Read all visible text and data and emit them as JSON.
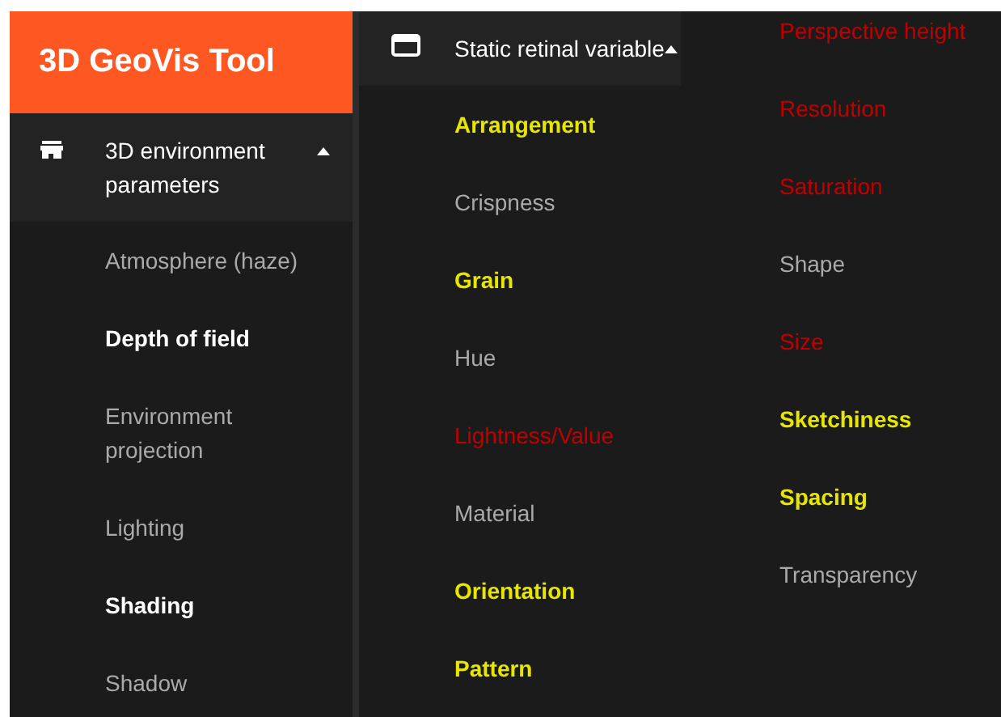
{
  "app": {
    "title": "3D GeoVis Tool"
  },
  "columns": [
    {
      "header": {
        "label": "3D environment parameters",
        "expanded": true
      },
      "items": [
        {
          "label": "Atmosphere (haze)",
          "color": "#aaaaaa",
          "bold": false
        },
        {
          "label": "Depth of field",
          "color": "#ffffff",
          "bold": true
        },
        {
          "label": "Environment projection",
          "color": "#aaaaaa",
          "bold": false
        },
        {
          "label": "Lighting",
          "color": "#aaaaaa",
          "bold": false
        },
        {
          "label": "Shading",
          "color": "#ffffff",
          "bold": true
        },
        {
          "label": "Shadow",
          "color": "#aaaaaa",
          "bold": false
        }
      ]
    },
    {
      "header": {
        "label": "Static retinal variable",
        "expanded": true
      },
      "items": [
        {
          "label": "Arrangement",
          "color": "#e6e600",
          "bold": true
        },
        {
          "label": "Crispness",
          "color": "#aaaaaa",
          "bold": false
        },
        {
          "label": "Grain",
          "color": "#e6e600",
          "bold": true
        },
        {
          "label": "Hue",
          "color": "#aaaaaa",
          "bold": false
        },
        {
          "label": "Lightness/Value",
          "color": "#c00000",
          "bold": false
        },
        {
          "label": "Material",
          "color": "#aaaaaa",
          "bold": false
        },
        {
          "label": "Orientation",
          "color": "#e6e600",
          "bold": true
        },
        {
          "label": "Pattern",
          "color": "#e6e600",
          "bold": true
        }
      ]
    },
    {
      "items": [
        {
          "label": "Perspective height",
          "color": "#c00000",
          "bold": false
        },
        {
          "label": "Resolution",
          "color": "#c00000",
          "bold": false
        },
        {
          "label": "Saturation",
          "color": "#c00000",
          "bold": false
        },
        {
          "label": "Shape",
          "color": "#aaaaaa",
          "bold": false
        },
        {
          "label": "Size",
          "color": "#c00000",
          "bold": false
        },
        {
          "label": "Sketchiness",
          "color": "#e6e600",
          "bold": true
        },
        {
          "label": "Spacing",
          "color": "#e6e600",
          "bold": true
        },
        {
          "label": "Transparency",
          "color": "#aaaaaa",
          "bold": false
        }
      ]
    }
  ]
}
